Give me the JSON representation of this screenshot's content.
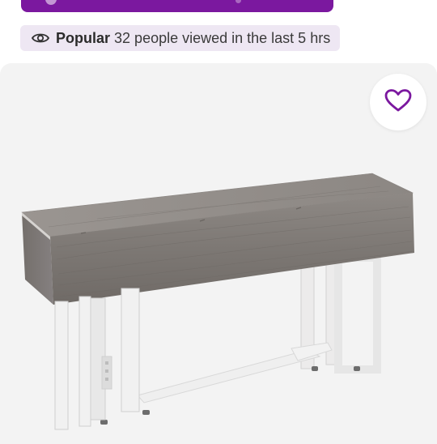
{
  "promo_banner": {
    "color": "#7b189f"
  },
  "popularity": {
    "icon": "eye-icon",
    "label": "Popular",
    "text": "32 people viewed in the last 5 hrs",
    "background": "#eee7f3"
  },
  "gallery": {
    "favorite_icon": "heart-icon",
    "accent": "#7b189f",
    "background": "#f3f3f3",
    "product_image": "drop-leaf-console-table"
  }
}
